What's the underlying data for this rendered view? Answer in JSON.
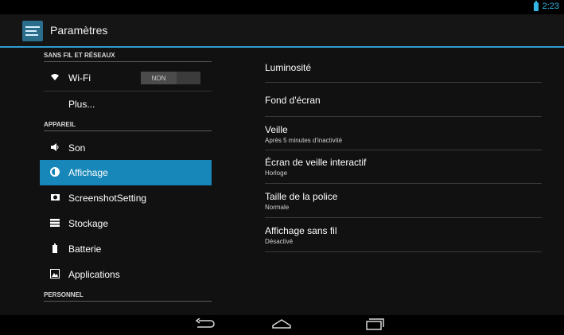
{
  "status_bar": {
    "time": "2:23",
    "battery_icon": "battery-icon"
  },
  "app_bar": {
    "title": "Paramètres",
    "icon": "settings-icon"
  },
  "sidebar": {
    "section_wireless": "SANS FIL ET RÉSEAUX",
    "wifi_label": "Wi-Fi",
    "wifi_toggle": "NON",
    "more_label": "Plus...",
    "section_device": "APPAREIL",
    "son_label": "Son",
    "display_label": "Affichage",
    "screenshot_label": "ScreenshotSetting",
    "storage_label": "Stockage",
    "battery_label": "Batterie",
    "apps_label": "Applications",
    "section_personal": "PERSONNEL"
  },
  "display_settings": {
    "brightness": {
      "title": "Luminosité"
    },
    "wallpaper": {
      "title": "Fond d'écran"
    },
    "sleep": {
      "title": "Veille",
      "summary": "Après 5 minutes d'inactivité"
    },
    "daydream": {
      "title": "Écran de veille interactif",
      "summary": "Horloge"
    },
    "font_size": {
      "title": "Taille de la police",
      "summary": "Normale"
    },
    "wireless_display": {
      "title": "Affichage sans fil",
      "summary": "Désactivé"
    }
  },
  "nav_bar": {
    "back_icon": "back-icon",
    "home_icon": "home-icon",
    "recent_icon": "recent-apps-icon"
  },
  "colors": {
    "accent": "#33b5e5",
    "selected": "#1786b8",
    "divider": "#2f9bd1"
  }
}
